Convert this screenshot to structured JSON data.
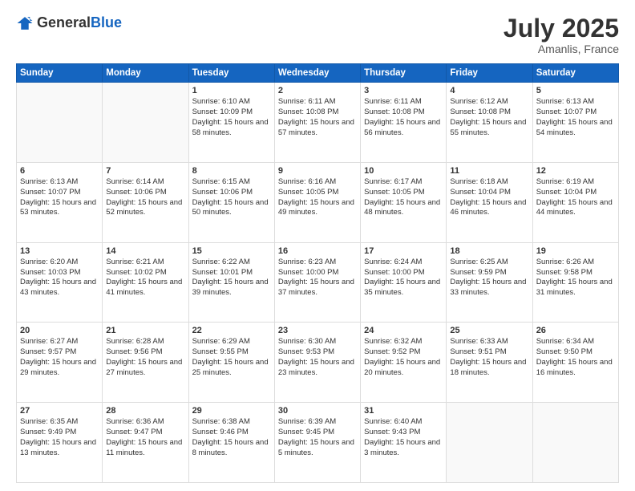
{
  "header": {
    "logo_general": "General",
    "logo_blue": "Blue",
    "month_year": "July 2025",
    "location": "Amanlis, France"
  },
  "days_of_week": [
    "Sunday",
    "Monday",
    "Tuesday",
    "Wednesday",
    "Thursday",
    "Friday",
    "Saturday"
  ],
  "weeks": [
    [
      {
        "day": "",
        "empty": true
      },
      {
        "day": "",
        "empty": true
      },
      {
        "day": "1",
        "sunrise": "Sunrise: 6:10 AM",
        "sunset": "Sunset: 10:09 PM",
        "daylight": "Daylight: 15 hours and 58 minutes."
      },
      {
        "day": "2",
        "sunrise": "Sunrise: 6:11 AM",
        "sunset": "Sunset: 10:08 PM",
        "daylight": "Daylight: 15 hours and 57 minutes."
      },
      {
        "day": "3",
        "sunrise": "Sunrise: 6:11 AM",
        "sunset": "Sunset: 10:08 PM",
        "daylight": "Daylight: 15 hours and 56 minutes."
      },
      {
        "day": "4",
        "sunrise": "Sunrise: 6:12 AM",
        "sunset": "Sunset: 10:08 PM",
        "daylight": "Daylight: 15 hours and 55 minutes."
      },
      {
        "day": "5",
        "sunrise": "Sunrise: 6:13 AM",
        "sunset": "Sunset: 10:07 PM",
        "daylight": "Daylight: 15 hours and 54 minutes."
      }
    ],
    [
      {
        "day": "6",
        "sunrise": "Sunrise: 6:13 AM",
        "sunset": "Sunset: 10:07 PM",
        "daylight": "Daylight: 15 hours and 53 minutes."
      },
      {
        "day": "7",
        "sunrise": "Sunrise: 6:14 AM",
        "sunset": "Sunset: 10:06 PM",
        "daylight": "Daylight: 15 hours and 52 minutes."
      },
      {
        "day": "8",
        "sunrise": "Sunrise: 6:15 AM",
        "sunset": "Sunset: 10:06 PM",
        "daylight": "Daylight: 15 hours and 50 minutes."
      },
      {
        "day": "9",
        "sunrise": "Sunrise: 6:16 AM",
        "sunset": "Sunset: 10:05 PM",
        "daylight": "Daylight: 15 hours and 49 minutes."
      },
      {
        "day": "10",
        "sunrise": "Sunrise: 6:17 AM",
        "sunset": "Sunset: 10:05 PM",
        "daylight": "Daylight: 15 hours and 48 minutes."
      },
      {
        "day": "11",
        "sunrise": "Sunrise: 6:18 AM",
        "sunset": "Sunset: 10:04 PM",
        "daylight": "Daylight: 15 hours and 46 minutes."
      },
      {
        "day": "12",
        "sunrise": "Sunrise: 6:19 AM",
        "sunset": "Sunset: 10:04 PM",
        "daylight": "Daylight: 15 hours and 44 minutes."
      }
    ],
    [
      {
        "day": "13",
        "sunrise": "Sunrise: 6:20 AM",
        "sunset": "Sunset: 10:03 PM",
        "daylight": "Daylight: 15 hours and 43 minutes."
      },
      {
        "day": "14",
        "sunrise": "Sunrise: 6:21 AM",
        "sunset": "Sunset: 10:02 PM",
        "daylight": "Daylight: 15 hours and 41 minutes."
      },
      {
        "day": "15",
        "sunrise": "Sunrise: 6:22 AM",
        "sunset": "Sunset: 10:01 PM",
        "daylight": "Daylight: 15 hours and 39 minutes."
      },
      {
        "day": "16",
        "sunrise": "Sunrise: 6:23 AM",
        "sunset": "Sunset: 10:00 PM",
        "daylight": "Daylight: 15 hours and 37 minutes."
      },
      {
        "day": "17",
        "sunrise": "Sunrise: 6:24 AM",
        "sunset": "Sunset: 10:00 PM",
        "daylight": "Daylight: 15 hours and 35 minutes."
      },
      {
        "day": "18",
        "sunrise": "Sunrise: 6:25 AM",
        "sunset": "Sunset: 9:59 PM",
        "daylight": "Daylight: 15 hours and 33 minutes."
      },
      {
        "day": "19",
        "sunrise": "Sunrise: 6:26 AM",
        "sunset": "Sunset: 9:58 PM",
        "daylight": "Daylight: 15 hours and 31 minutes."
      }
    ],
    [
      {
        "day": "20",
        "sunrise": "Sunrise: 6:27 AM",
        "sunset": "Sunset: 9:57 PM",
        "daylight": "Daylight: 15 hours and 29 minutes."
      },
      {
        "day": "21",
        "sunrise": "Sunrise: 6:28 AM",
        "sunset": "Sunset: 9:56 PM",
        "daylight": "Daylight: 15 hours and 27 minutes."
      },
      {
        "day": "22",
        "sunrise": "Sunrise: 6:29 AM",
        "sunset": "Sunset: 9:55 PM",
        "daylight": "Daylight: 15 hours and 25 minutes."
      },
      {
        "day": "23",
        "sunrise": "Sunrise: 6:30 AM",
        "sunset": "Sunset: 9:53 PM",
        "daylight": "Daylight: 15 hours and 23 minutes."
      },
      {
        "day": "24",
        "sunrise": "Sunrise: 6:32 AM",
        "sunset": "Sunset: 9:52 PM",
        "daylight": "Daylight: 15 hours and 20 minutes."
      },
      {
        "day": "25",
        "sunrise": "Sunrise: 6:33 AM",
        "sunset": "Sunset: 9:51 PM",
        "daylight": "Daylight: 15 hours and 18 minutes."
      },
      {
        "day": "26",
        "sunrise": "Sunrise: 6:34 AM",
        "sunset": "Sunset: 9:50 PM",
        "daylight": "Daylight: 15 hours and 16 minutes."
      }
    ],
    [
      {
        "day": "27",
        "sunrise": "Sunrise: 6:35 AM",
        "sunset": "Sunset: 9:49 PM",
        "daylight": "Daylight: 15 hours and 13 minutes."
      },
      {
        "day": "28",
        "sunrise": "Sunrise: 6:36 AM",
        "sunset": "Sunset: 9:47 PM",
        "daylight": "Daylight: 15 hours and 11 minutes."
      },
      {
        "day": "29",
        "sunrise": "Sunrise: 6:38 AM",
        "sunset": "Sunset: 9:46 PM",
        "daylight": "Daylight: 15 hours and 8 minutes."
      },
      {
        "day": "30",
        "sunrise": "Sunrise: 6:39 AM",
        "sunset": "Sunset: 9:45 PM",
        "daylight": "Daylight: 15 hours and 5 minutes."
      },
      {
        "day": "31",
        "sunrise": "Sunrise: 6:40 AM",
        "sunset": "Sunset: 9:43 PM",
        "daylight": "Daylight: 15 hours and 3 minutes."
      },
      {
        "day": "",
        "empty": true
      },
      {
        "day": "",
        "empty": true
      }
    ]
  ]
}
